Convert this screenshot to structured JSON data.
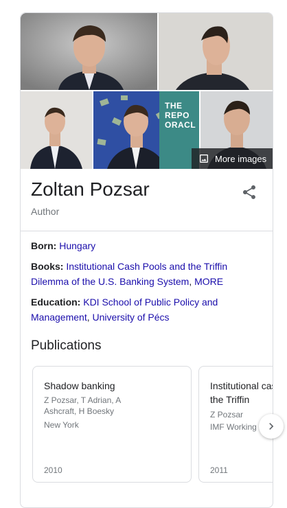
{
  "photos": {
    "overlay_text": [
      "THE",
      "REPO",
      "ORACL"
    ],
    "more_images_label": "More images"
  },
  "entity": {
    "name": "Zoltan Pozsar",
    "subtitle": "Author"
  },
  "facts": {
    "born_label": "Born:",
    "born_value": "Hungary",
    "books_label": "Books:",
    "books_value_1": "Institutional Cash Pools and the Triffin Dilemma of the U.S. Banking System",
    "books_sep": ", ",
    "books_more": "MORE",
    "education_label": "Education:",
    "education_value_1": "KDI School of Public Policy and Management",
    "education_sep": ", ",
    "education_value_2": "University of Pécs"
  },
  "publications": {
    "heading": "Publications",
    "items": [
      {
        "title": "Shadow banking",
        "authors": "Z Pozsar, T Adrian, A Ashcraft, H Boesky",
        "publisher": "New York",
        "year": "2010"
      },
      {
        "title": "Institutional cash pools and the Triffin",
        "authors": "Z Pozsar",
        "publisher": "IMF Working Paper",
        "year": "2011"
      }
    ]
  },
  "colors": {
    "link": "#1a0dab",
    "border": "#dadce0",
    "muted": "#70757a"
  }
}
